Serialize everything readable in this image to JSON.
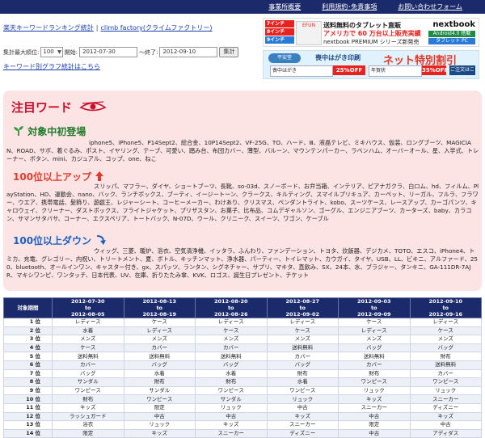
{
  "nav": [
    "事業所概要",
    "利用規約･免責事項",
    "お問い合わせフォーム"
  ],
  "header": {
    "site_link": "楽天キーワードランキング統計",
    "separator": "|",
    "sub_link": "climb factory(クライムファクトリー)"
  },
  "range": {
    "label_max": "集計最大順位:",
    "max_value": "100",
    "label_start": "開始:",
    "start_value": "2012-07-30",
    "label_end": "～終了:",
    "end_value": "2012-09-10",
    "submit": "集計"
  },
  "graph_link": "キーワード別グラフ統計はこちら",
  "ad_tablet": {
    "slips": [
      "7インチ",
      "8インチ",
      "9インチ"
    ],
    "tab_text": "EFUN",
    "line1": "送料無料のタブレット直販",
    "line2": "アメリカで 60 万台以上販売実績",
    "line3": "nextbook PREMIUM シリーズ新発売",
    "brand": "nextbook",
    "badge1": "Android4.0 搭載",
    "badge2": "タブレット PC"
  },
  "ad_print": {
    "logo": "平安堂",
    "main": "喪中はがき印刷",
    "big": "ネット特別割引",
    "c1": "喪中はがき",
    "p1": "25%OFF",
    "c2": "年賀状",
    "p2": "35%OFF",
    "cta": "ご注文はこちら"
  },
  "featured": {
    "title": "注目ワード",
    "new_title": "対象中初登場",
    "new_text": "iphone5、iPhone5、P14Sept2、総合金、10P14Sept2、VF-25G、TO、ハード、Ⅲ、液晶テレビ、ミキハウス、仮装、ロングブーツ、MAGICIAN、ROAD、サボ、着ぐるみ、ポスト、イヤリング、テープ、可愛い、踏み台、布団カバー、薄型、バルーン、マウンテンパーカー、ラベンハム、オーバーオール、星、入学式、トレーナー、ボタン、mini、カジュアル、コップ、one、ねこ",
    "up_title": "100位以上アップ",
    "up_text": "スリッパ、マフラー、ダイヤ、ショートブーツ、長靴、so-03d、スノーボード、お弁当箱、インテリア、ピアナガクラ、白ロム、hd、フィルム、PlayStation、HD、運動会、nano、バック、ランチボックス、ブーティ、イージートーン、クラークス、キルティング、スマイルプリキュア、カーペット、リーガル、フルラ、フラワー、ウエア、携帯電話、髪飾り、遊戯王、レジャーシート、コーヒーメーカー、わけあり、クリスマス、ペンダントライト、kobo、スーツケース、レースアップ、カーゴパンツ、キャロウェイ、クリーナー、ダストボックス、フライトジャケット、プリザスタン、お菓子、比布品、コムデギャルソン、ゴーグル、エンジニアブーツ、カーターズ、baby、カラコン、サマンサタバサ、コーナー、エクスペリア、トートバック、N-07D、ウール、クリニーク、スイーツ、ワゴン、ケーブル",
    "down_title": "100位以上ダウン",
    "down_text": "ウィッグ、三菱、暖炉、浴衣、空気清浄機、イッタラ、ふんわり、ファンデーション、トヨタ、炊飯器、デジカメ、TOTO、エスコ、iPhone4、トミカ、充電、グレゴリー、内祝い、トリートメント、夏、ボトル、キッチンマット、浄水器、パーティー、トイレマット、カウガイ、タイヤ、USB、LL、ビキニ、アルファード、250、bluetooth、オールインワン、キャスター付き、gx、スパッツ、ランタン、シグネチャー、サプリ、マキタ、直飲み、SX、24本、水、ブラジャー、タンキニ、GA-111DR-7AJR、マキシワンピ、ワンタッチ、日本代表、UV、在庫、折りたたみ傘、KVK、ロゴス、誕生日プレゼント、チケット"
  },
  "table": {
    "period_header": "対象期間",
    "periods": [
      {
        "start": "2012-07-30",
        "to": "to",
        "end": "2012-08-05"
      },
      {
        "start": "2012-08-13",
        "to": "to",
        "end": "2012-08-19"
      },
      {
        "start": "2012-08-20",
        "to": "to",
        "end": "2012-08-26"
      },
      {
        "start": "2012-08-27",
        "to": "to",
        "end": "2012-09-02"
      },
      {
        "start": "2012-09-03",
        "to": "to",
        "end": "2012-09-09"
      },
      {
        "start": "2012-09-10",
        "to": "to",
        "end": "2012-09-16"
      }
    ],
    "rows": [
      {
        "rank": "1 位",
        "cells": [
          "レディース",
          "ケース",
          "レディース",
          "レディース",
          "ケース",
          "レディース"
        ]
      },
      {
        "rank": "2 位",
        "cells": [
          "水着",
          "レディース",
          "ケース",
          "ケース",
          "レディース",
          "ケース"
        ]
      },
      {
        "rank": "3 位",
        "cells": [
          "メンズ",
          "メンズ",
          "メンズ",
          "メンズ",
          "メンズ",
          "メンズ"
        ]
      },
      {
        "rank": "4 位",
        "cells": [
          "ケース",
          "カバー",
          "カバー",
          "送料無料",
          "バッグ",
          "バッグ"
        ]
      },
      {
        "rank": "5 位",
        "cells": [
          "送料無料",
          "送料無料",
          "送料無料",
          "カバー",
          "送料無料",
          "財布"
        ]
      },
      {
        "rank": "6 位",
        "cells": [
          "カバー",
          "バッグ",
          "バッグ",
          "バッグ",
          "カバー",
          "送料無料"
        ]
      },
      {
        "rank": "7 位",
        "cells": [
          "バッグ",
          "水着",
          "水着",
          "財布",
          "財布",
          "カバー"
        ]
      },
      {
        "rank": "8 位",
        "cells": [
          "サンダル",
          "財布",
          "財布",
          "水着",
          "ワンピース",
          "ワンピース"
        ]
      },
      {
        "rank": "9 位",
        "cells": [
          "ワンピース",
          "サンダル",
          "ワンピース",
          "ワンピース",
          "リュック",
          "リュック"
        ]
      },
      {
        "rank": "10 位",
        "cells": [
          "財布",
          "ワンピース",
          "サンダル",
          "リュック",
          "キッズ",
          "スニーカー"
        ]
      },
      {
        "rank": "11 位",
        "cells": [
          "キッズ",
          "限定",
          "リュック",
          "中古",
          "スニーカー",
          "ディズニー"
        ]
      },
      {
        "rank": "12 位",
        "cells": [
          "ラッシュガード",
          "中古",
          "中古",
          "キッズ",
          "中古",
          "キッズ"
        ]
      },
      {
        "rank": "13 位",
        "cells": [
          "浴衣",
          "リュック",
          "キッズ",
          "スニーカー",
          "限定",
          "中古"
        ]
      },
      {
        "rank": "14 位",
        "cells": [
          "限定",
          "キッズ",
          "スニーカー",
          "ディズニー",
          "中古",
          "アディダス"
        ]
      }
    ]
  }
}
